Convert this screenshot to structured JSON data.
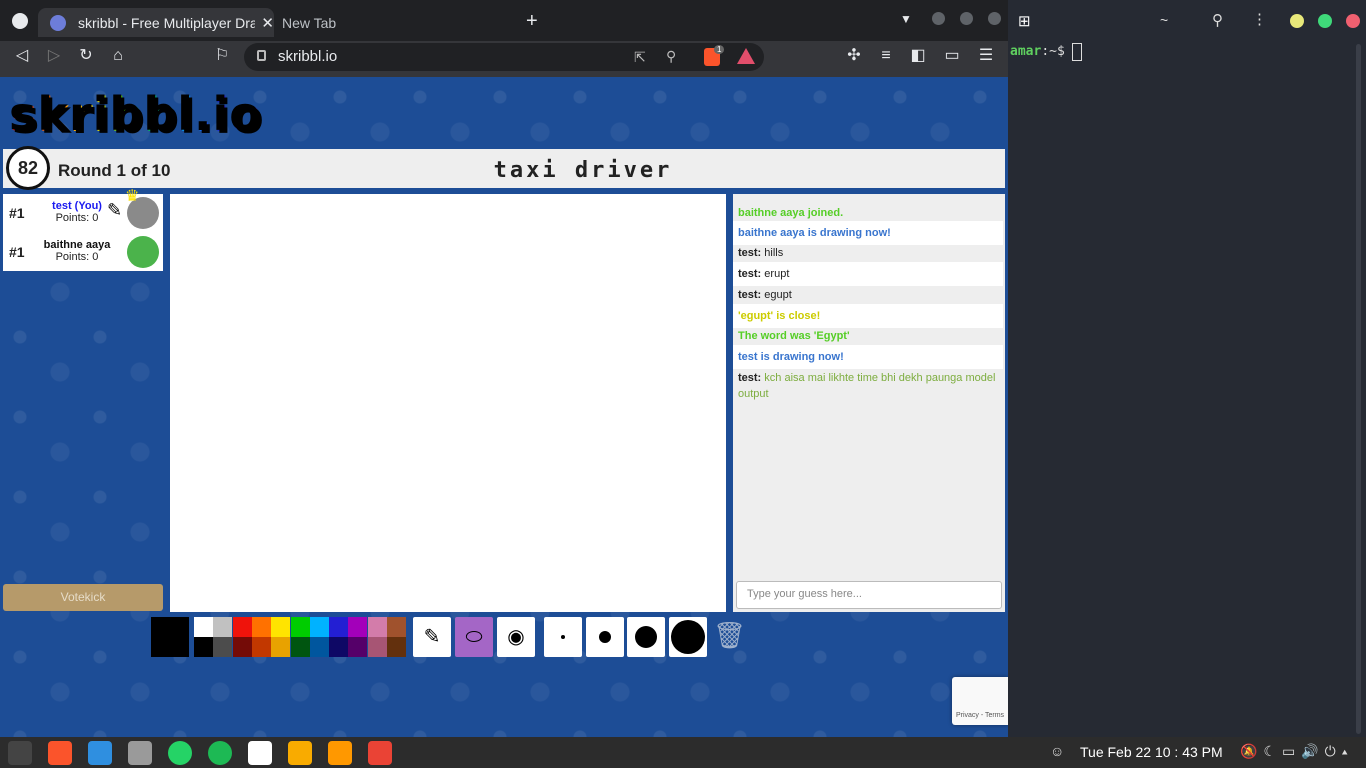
{
  "browser": {
    "tabs": [
      {
        "label": "skribbl - Free Multiplayer Draw",
        "close": "✕"
      },
      {
        "label": "New Tab"
      }
    ],
    "new_tab": "+",
    "url": "skribbl.io",
    "brave_badge": "1"
  },
  "game": {
    "logo": "skribbl.io",
    "timer": "82",
    "round": "Round 1 of 10",
    "word": "taxi driver",
    "players": [
      {
        "rank": "#1",
        "name": "test (You)",
        "points": "Points: 0",
        "name_color": "#1a1af0",
        "avatar_color": "#8a8a8a"
      },
      {
        "rank": "#1",
        "name": "baithne aaya",
        "points": "Points: 0",
        "name_color": "#111111",
        "avatar_color": "#4bb34b"
      }
    ],
    "votekick": "Votekick",
    "chat": [
      {
        "sender": "",
        "text": "baithne aaya joined.",
        "color": "#56ce27",
        "bold": true
      },
      {
        "sender": "",
        "text": "baithne aaya is drawing now!",
        "color": "#3975ce",
        "bold": true
      },
      {
        "sender": "test:",
        "text": "hills",
        "color": "#222222",
        "bold": false
      },
      {
        "sender": "test:",
        "text": "erupt",
        "color": "#222222",
        "bold": false
      },
      {
        "sender": "test:",
        "text": "egupt",
        "color": "#222222",
        "bold": false
      },
      {
        "sender": "",
        "text": "'egupt' is close!",
        "color": "#cccc00",
        "bold": true
      },
      {
        "sender": "",
        "text": "The word was 'Egypt'",
        "color": "#56ce27",
        "bold": true
      },
      {
        "sender": "",
        "text": "test is drawing now!",
        "color": "#3975ce",
        "bold": true
      },
      {
        "sender": "test:",
        "text": "kch aisa mai likhte time bhi dekh paunga model output",
        "color": "#7dad3f",
        "bold": false
      }
    ],
    "guess_placeholder": "Type your guess here...",
    "colors_top": [
      "#ffffff",
      "#c1c1c1",
      "#ef130b",
      "#ff7100",
      "#ffe400",
      "#00cc00",
      "#00b2ff",
      "#231fd3",
      "#a300ba",
      "#d37caa",
      "#a0522d"
    ],
    "colors_bottom": [
      "#000000",
      "#4c4c4c",
      "#740b07",
      "#c23800",
      "#e8a200",
      "#005510",
      "#00569e",
      "#0e0865",
      "#550069",
      "#a75574",
      "#63300d"
    ],
    "selected_color": "#000000",
    "recaptcha": "Privacy - Terms"
  },
  "terminal": {
    "prompt_user": "amar",
    "prompt_rest": ":~$",
    "title": "~"
  },
  "taskbar": {
    "datetime": "Tue Feb 22  10 : 43 PM"
  }
}
